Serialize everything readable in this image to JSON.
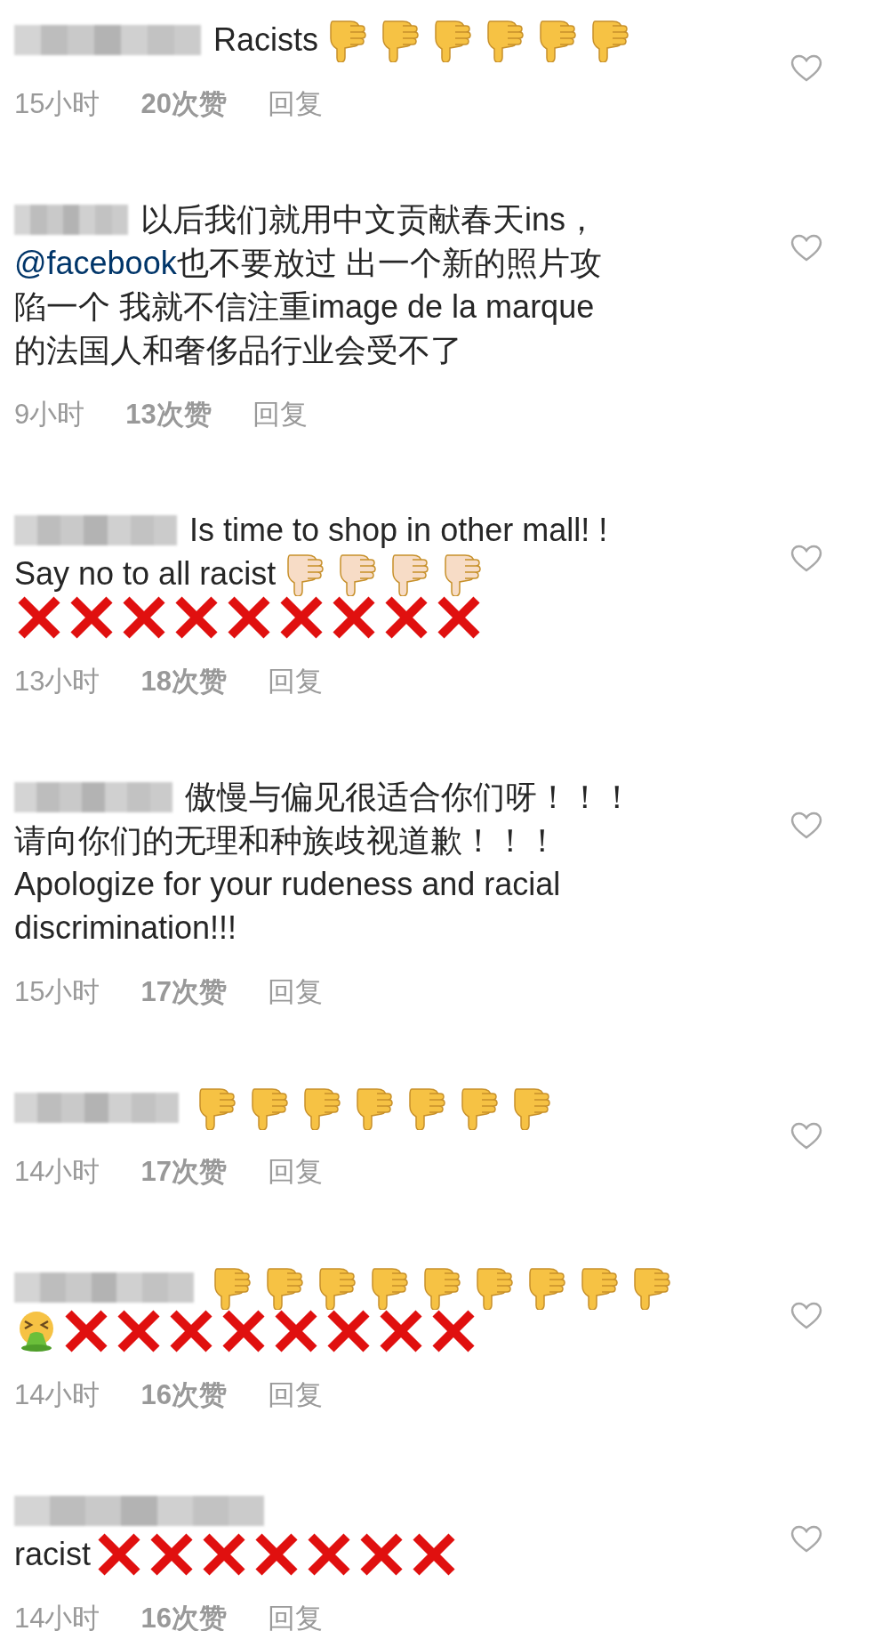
{
  "comments": [
    {
      "lines": [
        [
          {
            "kind": "blurred_name"
          },
          {
            "kind": "text",
            "text": "Racists"
          },
          {
            "kind": "thumb",
            "color": "#f6c244"
          },
          {
            "kind": "thumb",
            "color": "#f6c244"
          },
          {
            "kind": "thumb",
            "color": "#f6c244"
          },
          {
            "kind": "thumb",
            "color": "#f6c244"
          },
          {
            "kind": "thumb",
            "color": "#f6c244"
          },
          {
            "kind": "thumb",
            "color": "#f6c244"
          }
        ]
      ],
      "time": "15小时",
      "likes": "20次赞",
      "reply": "回复",
      "liked": false
    },
    {
      "lines": [
        [
          {
            "kind": "blurred_name"
          },
          {
            "kind": "text",
            "text": "以后我们就用中文贡献春天ins，"
          }
        ],
        [
          {
            "kind": "mention",
            "text": "@facebook"
          },
          {
            "kind": "text",
            "text": "也不要放过 出一个新的照片攻"
          }
        ],
        [
          {
            "kind": "text",
            "text": "陷一个 我就不信注重image de la marque"
          }
        ],
        [
          {
            "kind": "text",
            "text": "的法国人和奢侈品行业会受不了"
          }
        ]
      ],
      "time": "9小时",
      "likes": "13次赞",
      "reply": "回复",
      "liked": false
    },
    {
      "lines": [
        [
          {
            "kind": "blurred_name"
          },
          {
            "kind": "text",
            "text": "Is time to shop in other mall! !"
          }
        ],
        [
          {
            "kind": "text",
            "text": "Say no to all racist"
          },
          {
            "kind": "thumb",
            "color": "#f7dcc6"
          },
          {
            "kind": "thumb",
            "color": "#f7dcc6"
          },
          {
            "kind": "thumb",
            "color": "#f7dcc6"
          },
          {
            "kind": "thumb",
            "color": "#f7dcc6"
          }
        ],
        [
          {
            "kind": "cross"
          },
          {
            "kind": "cross"
          },
          {
            "kind": "cross"
          },
          {
            "kind": "cross"
          },
          {
            "kind": "cross"
          },
          {
            "kind": "cross"
          },
          {
            "kind": "cross"
          },
          {
            "kind": "cross"
          },
          {
            "kind": "cross"
          }
        ]
      ],
      "time": "13小时",
      "likes": "18次赞",
      "reply": "回复",
      "liked": false
    },
    {
      "lines": [
        [
          {
            "kind": "blurred_name"
          },
          {
            "kind": "text",
            "text": "傲慢与偏见很适合你们呀！！！"
          }
        ],
        [
          {
            "kind": "text",
            "text": "请向你们的无理和种族歧视道歉！！！"
          }
        ],
        [
          {
            "kind": "text",
            "text": "Apologize for your rudeness and racial"
          }
        ],
        [
          {
            "kind": "text",
            "text": "discrimination!!!"
          }
        ]
      ],
      "time": "15小时",
      "likes": "17次赞",
      "reply": "回复",
      "liked": false
    },
    {
      "lines": [
        [
          {
            "kind": "blurred_name"
          },
          {
            "kind": "thumb",
            "color": "#f6c244"
          },
          {
            "kind": "thumb",
            "color": "#f6c244"
          },
          {
            "kind": "thumb",
            "color": "#f6c244"
          },
          {
            "kind": "thumb",
            "color": "#f6c244"
          },
          {
            "kind": "thumb",
            "color": "#f6c244"
          },
          {
            "kind": "thumb",
            "color": "#f6c244"
          },
          {
            "kind": "thumb",
            "color": "#f6c244"
          }
        ]
      ],
      "time": "14小时",
      "likes": "17次赞",
      "reply": "回复",
      "liked": false
    },
    {
      "lines": [
        [
          {
            "kind": "blurred_name"
          },
          {
            "kind": "thumb",
            "color": "#f6c244"
          },
          {
            "kind": "thumb",
            "color": "#f6c244"
          },
          {
            "kind": "thumb",
            "color": "#f6c244"
          },
          {
            "kind": "thumb",
            "color": "#f6c244"
          },
          {
            "kind": "thumb",
            "color": "#f6c244"
          },
          {
            "kind": "thumb",
            "color": "#f6c244"
          },
          {
            "kind": "thumb",
            "color": "#f6c244"
          },
          {
            "kind": "thumb",
            "color": "#f6c244"
          },
          {
            "kind": "thumb",
            "color": "#f6c244"
          }
        ],
        [
          {
            "kind": "sick"
          },
          {
            "kind": "cross"
          },
          {
            "kind": "cross"
          },
          {
            "kind": "cross"
          },
          {
            "kind": "cross"
          },
          {
            "kind": "cross"
          },
          {
            "kind": "cross"
          },
          {
            "kind": "cross"
          },
          {
            "kind": "cross"
          }
        ]
      ],
      "time": "14小时",
      "likes": "16次赞",
      "reply": "回复",
      "liked": false
    },
    {
      "lines": [
        [
          {
            "kind": "blurred_name"
          }
        ],
        [
          {
            "kind": "text",
            "text": "racist"
          },
          {
            "kind": "cross"
          },
          {
            "kind": "cross"
          },
          {
            "kind": "cross"
          },
          {
            "kind": "cross"
          },
          {
            "kind": "cross"
          },
          {
            "kind": "cross"
          },
          {
            "kind": "cross"
          }
        ]
      ],
      "time": "14小时",
      "likes": "16次赞",
      "reply": "回复",
      "liked": false
    }
  ]
}
